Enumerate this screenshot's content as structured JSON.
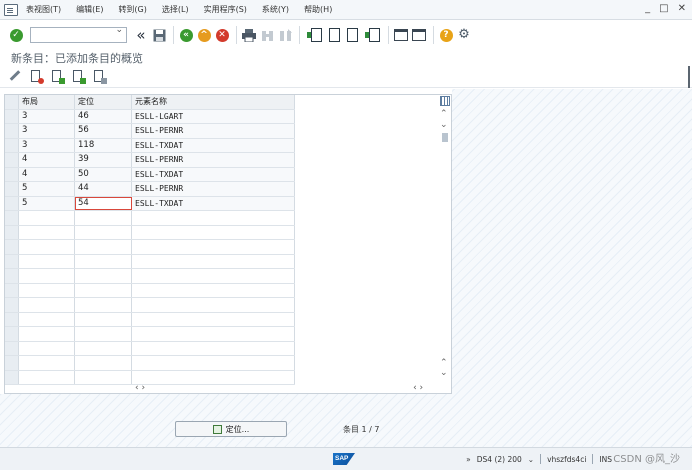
{
  "menu": {
    "items": [
      "表视图(T)",
      "编辑(E)",
      "转到(G)",
      "选择(L)",
      "实用程序(S)",
      "系统(Y)",
      "帮助(H)"
    ],
    "window_controls": [
      "_",
      "□",
      "✕"
    ]
  },
  "toolbar": {
    "command_value": "",
    "icons": [
      "enter-icon",
      "save-icon",
      "back-icon",
      "exit-icon",
      "cancel-icon",
      "print-icon",
      "find-icon",
      "find-next-icon",
      "first-page-icon",
      "previous-page-icon",
      "next-page-icon",
      "last-page-icon",
      "create-session-icon",
      "shortcut-icon",
      "help-icon",
      "customize-icon"
    ],
    "back_glyph": "«",
    "help_glyph": "?"
  },
  "page": {
    "title": "新条目：已添加条目的概览"
  },
  "table": {
    "columns": [
      "布局",
      "定位",
      "元素名称"
    ],
    "rows": [
      [
        "3",
        "46",
        "ESLL-LGART"
      ],
      [
        "3",
        "56",
        "ESLL-PERNR"
      ],
      [
        "3",
        "118",
        "ESLL-TXDAT"
      ],
      [
        "4",
        "39",
        "ESLL-PERNR"
      ],
      [
        "4",
        "50",
        "ESLL-TXDAT"
      ],
      [
        "5",
        "44",
        "ESLL-PERNR"
      ],
      [
        "5",
        "54",
        "ESLL-TXDAT"
      ]
    ],
    "empty_rows": 12,
    "scroll_left_glyphs": "‹ ›",
    "scroll_right_glyphs": "‹ ›"
  },
  "footer": {
    "position_button_label": "定位...",
    "entry_info": "条目 1 / 7"
  },
  "status": {
    "logo": "SAP",
    "system": "DS4 (2) 200",
    "host": "vhszfds4ci",
    "mode": "INS",
    "watermark": "CSDN @风_沙"
  }
}
